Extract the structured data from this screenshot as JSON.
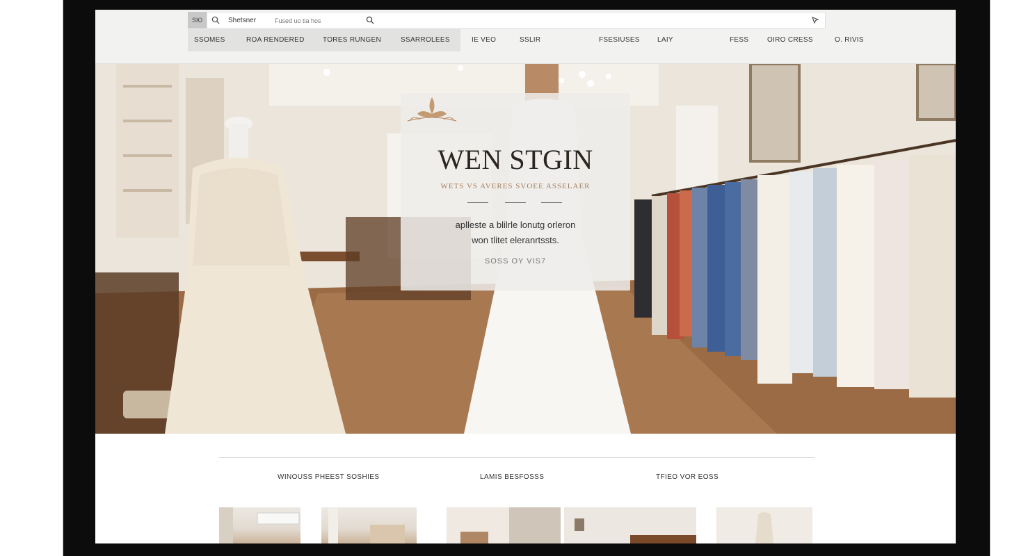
{
  "header": {
    "search_prefix": "SЮ",
    "search_label": "Shetsner",
    "search_placeholder": "Fused uo tia hos",
    "nav": [
      "SSOMES",
      "ROA RENDERED",
      "TORES RUNGEN",
      "SSARROLEES",
      "IE VEO",
      "SSLIR",
      "FSESIUSES",
      "LAIY",
      "FESS",
      "OIRO CRESS",
      "O. RIVIS"
    ]
  },
  "hero": {
    "title": "WEN STGIN",
    "subtitle": "WETS VS AVERES SVOEE ASSELAER",
    "body_line1": "aplleste a blilrle lonutg orleron",
    "body_line2": "won tlitet eleranrtssts.",
    "cta": "SOSS OY VIS7"
  },
  "sections": [
    {
      "label": "WINOUSS PHEEST SOSHIES"
    },
    {
      "label": "LAMIS BESFOSSS"
    },
    {
      "label": "TFIEO VOR EOSS"
    }
  ],
  "colors": {
    "frame": "#0c0c0c",
    "topbar": "#f2f2f1",
    "card_overlay": "#eeeceadb",
    "accent_gold": "#a67f5e",
    "title_text": "#2b2622"
  },
  "icons": [
    "search-icon",
    "search-icon",
    "cursor-icon",
    "crest-ornament"
  ]
}
